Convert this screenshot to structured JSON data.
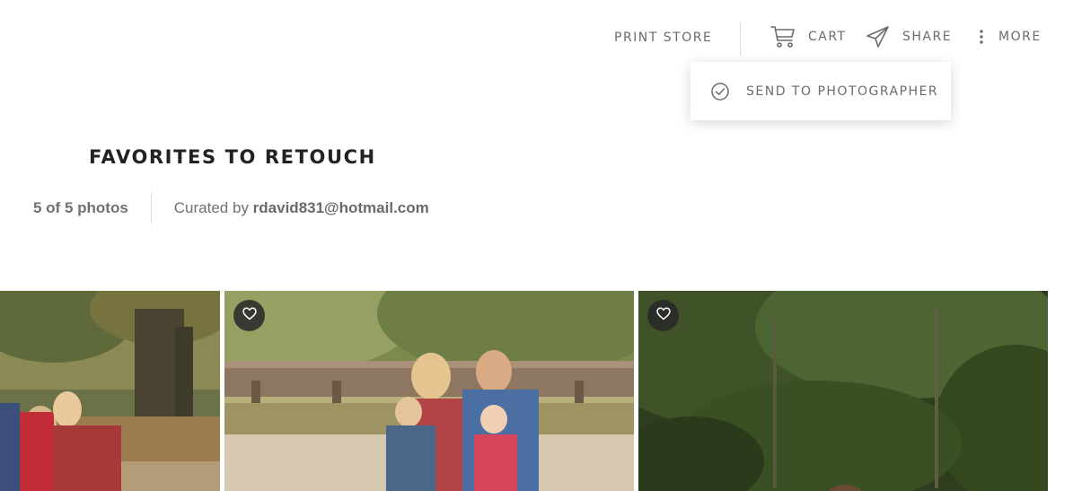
{
  "nav": {
    "print_store": "PRINT STORE",
    "cart": "CART",
    "share": "SHARE",
    "more": "MORE"
  },
  "more_menu": {
    "items": [
      {
        "label": "SEND TO PHOTOGRAPHER",
        "icon": "check-circle-icon"
      }
    ]
  },
  "gallery": {
    "title": "FAVORITES TO RETOUCH",
    "count": "5 of 5 photos",
    "curated_prefix": "Curated by ",
    "curator": "rdavid831@hotmail.com"
  },
  "photos": [
    {
      "subject": "family portrait under oak trees",
      "favorite_icon": "heart-icon"
    },
    {
      "subject": "family portrait on wooden pier by bridge",
      "favorite_icon": "heart-icon"
    },
    {
      "subject": "green forest backdrop",
      "favorite_icon": "heart-icon"
    }
  ],
  "colors": {
    "text_muted": "#6b6b6b",
    "title": "#222222",
    "fav_button": "#2c2c2c"
  }
}
